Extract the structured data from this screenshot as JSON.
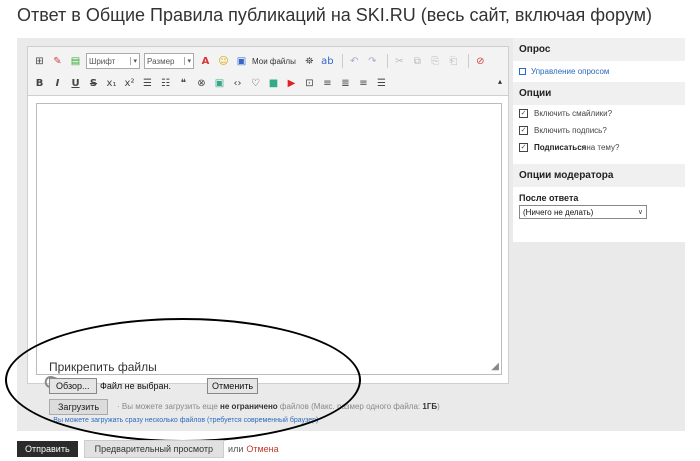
{
  "page": {
    "title": "Ответ в Общие Правила публикаций на SKI.RU (весь сайт, включая форум)"
  },
  "toolbar": {
    "font_select": "Шрифт",
    "size_select": "Размер",
    "my_files": "Мои файлы",
    "row1_icons": [
      "source-icon",
      "eraser-icon",
      "table-icon"
    ],
    "row2_icons": [
      {
        "name": "bold-icon",
        "glyph": "B"
      },
      {
        "name": "italic-icon",
        "glyph": "I"
      },
      {
        "name": "underline-icon",
        "glyph": "U"
      },
      {
        "name": "strike-icon",
        "glyph": "S"
      },
      {
        "name": "subscript-icon",
        "glyph": "x₁"
      },
      {
        "name": "superscript-icon",
        "glyph": "x²"
      },
      {
        "name": "ordered-list-icon",
        "glyph": "☰"
      },
      {
        "name": "unordered-list-icon",
        "glyph": "☷"
      },
      {
        "name": "quote-icon",
        "glyph": "❝"
      },
      {
        "name": "link-icon",
        "glyph": "⊗"
      },
      {
        "name": "image-icon",
        "glyph": "▣"
      },
      {
        "name": "code-icon",
        "glyph": "‹›"
      },
      {
        "name": "comment-icon",
        "glyph": "♡"
      },
      {
        "name": "media-icon",
        "glyph": "■"
      },
      {
        "name": "youtube-icon",
        "glyph": "▶"
      },
      {
        "name": "special-char-icon",
        "glyph": "⊡"
      },
      {
        "name": "align-left-icon",
        "glyph": "≡"
      },
      {
        "name": "align-center-icon",
        "glyph": "≣"
      },
      {
        "name": "align-right-icon",
        "glyph": "≡"
      },
      {
        "name": "justify-icon",
        "glyph": "☰"
      }
    ]
  },
  "attach": {
    "title": "Прикрепить файлы",
    "browse": "Обзор...",
    "no_file": "Файл не выбран.",
    "cancel": "Отменить",
    "upload": "Загрузить",
    "note_prefix": "· Вы можете загрузить еще",
    "note_bold": "не ограничено",
    "note_mid": "файлов (Макс. размер одного файла:",
    "note_size": "1ГБ",
    "note_end": ")",
    "multi": "· Вы можете загружать сразу несколько файлов (требуется современный браузер)"
  },
  "sidebar": {
    "poll_header": "Опрос",
    "poll_link": "Управление опросом",
    "options_header": "Опции",
    "options": [
      {
        "label": "Включить смайлики?",
        "checked": true
      },
      {
        "label": "Включить подпись?",
        "checked": true
      }
    ],
    "subscribe_bold": "Подписаться",
    "subscribe_rest": " на тему?",
    "moderator_header": "Опции модератора",
    "after_label": "После ответа",
    "after_value": "(Ничего не делать)"
  },
  "bottom": {
    "send": "Отправить",
    "preview": "Предварительный просмотр",
    "or": "или",
    "cancel": "Отмена"
  }
}
